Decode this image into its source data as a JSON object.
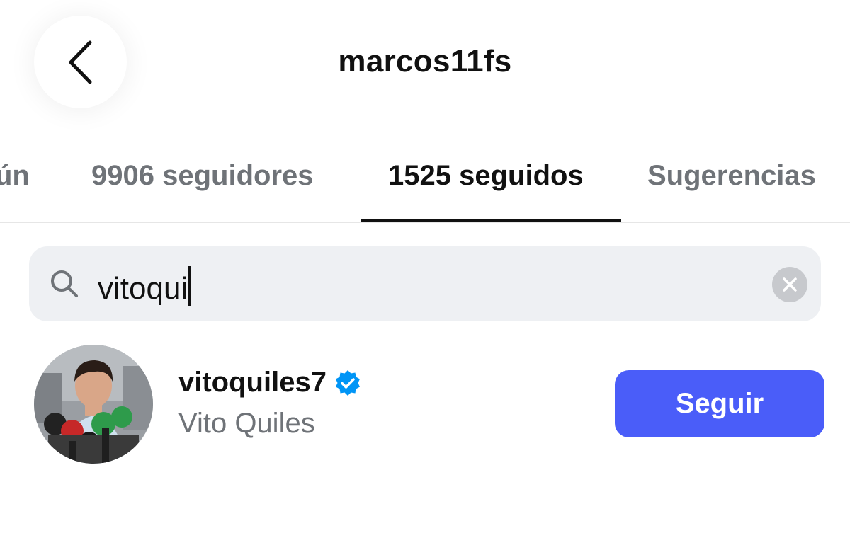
{
  "header": {
    "title": "marcos11fs",
    "back_icon": "chevron-left-icon"
  },
  "tabs": [
    {
      "label": "En común",
      "visible_text": "ún",
      "active": false
    },
    {
      "label": "9906 seguidores",
      "active": false
    },
    {
      "label": "1525 seguidos",
      "active": true
    },
    {
      "label": "Sugerencias",
      "active": false
    }
  ],
  "search": {
    "value": "vitoqui",
    "search_icon": "search-icon",
    "clear_icon": "clear-icon"
  },
  "result": {
    "username": "vitoquiles7",
    "verified": true,
    "verified_icon": "verified-badge-icon",
    "full_name": "Vito Quiles",
    "follow_label": "Seguir"
  },
  "colors": {
    "accent": "#4a5df9",
    "verified": "#0095f6",
    "muted_text": "#6f7378",
    "search_bg": "#eef0f3"
  }
}
